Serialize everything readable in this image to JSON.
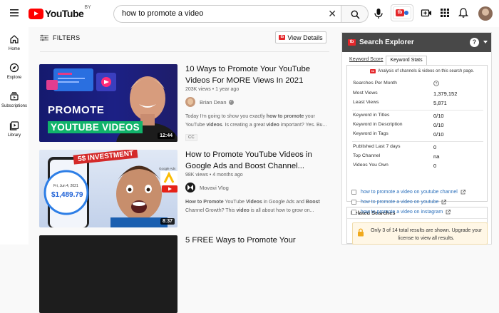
{
  "header": {
    "logo_text": "YouTube",
    "region": "BY",
    "search_value": "how to promote a video"
  },
  "sidebar": {
    "items": [
      {
        "label": "Home"
      },
      {
        "label": "Explore"
      },
      {
        "label": "Subscriptions"
      },
      {
        "label": "Library"
      }
    ]
  },
  "filters": {
    "label": "FILTERS",
    "view_details": "View Details"
  },
  "videos": [
    {
      "title": "10 Ways to Promote Your YouTube Videos For MORE Views In 2021",
      "meta": "203K views • 1 year ago",
      "channel": "Brian Dean",
      "desc_prefix": "Today I'm going to show you exactly ",
      "desc_b1": "how to promote",
      "desc_mid1": " your YouTube ",
      "desc_b2": "videos",
      "desc_mid2": ". Is creating a great ",
      "desc_b3": "video",
      "desc_suffix": " important? Yes. Bu...",
      "badge": "CC",
      "duration": "12:44",
      "thumb_line1": "PROMOTE",
      "thumb_line2": "YOUTUBE VIDEOS"
    },
    {
      "title": "How to Promote YouTube Videos in Google Ads and Boost Channel...",
      "meta": "98K views • 4 months ago",
      "channel": "Movavi Vlog",
      "desc_b1": "How to Promote",
      "desc_mid1": " YouTube ",
      "desc_b2": "Videos",
      "desc_mid2": " in Google Ads and ",
      "desc_b3": "Boost",
      "desc_mid3": " Channel Growth? This ",
      "desc_b4": "video",
      "desc_suffix": " is all about how to grow on...",
      "duration": "8:37",
      "thumb_banner": "5$ INVESTMENT",
      "thumb_date": "Fri, Jun 4, 2021",
      "thumb_amount": "$1,489.79",
      "thumb_brand": "Google Ads"
    },
    {
      "title": "5 FREE Ways to Promote Your"
    }
  ],
  "panel": {
    "title": "Search Explorer",
    "help": "?",
    "tabs": [
      "Keyword Score",
      "Keyword Stats"
    ],
    "note": "Analysis of channels & videos on this search page.",
    "stats": [
      {
        "k": "Searches Per Month",
        "v": ""
      },
      {
        "k": "Most Views",
        "v": "1,379,152"
      },
      {
        "k": "Least Views",
        "v": "5,871"
      },
      {
        "k": "Keyword in Titles",
        "v": "0/10"
      },
      {
        "k": "Keyword in Description",
        "v": "0/10"
      },
      {
        "k": "Keyword in Tags",
        "v": "0/10"
      },
      {
        "k": "Published Last 7 days",
        "v": "0"
      },
      {
        "k": "Top Channel",
        "v": "na"
      },
      {
        "k": "Videos You Own",
        "v": "0"
      }
    ],
    "related_title": "Related Searches",
    "related": [
      "how to promote a video on youtube channel",
      "how to promote a video on youtube",
      "how to promote a video on instagram"
    ],
    "upgrade": "Only 3 of 14 total results are shown. Upgrade your license to view all results."
  },
  "colors": {
    "brand_red": "#ff0000",
    "tb_red": "#e4262a",
    "panel_header": "#484848",
    "link_blue": "#2a6fbb"
  }
}
